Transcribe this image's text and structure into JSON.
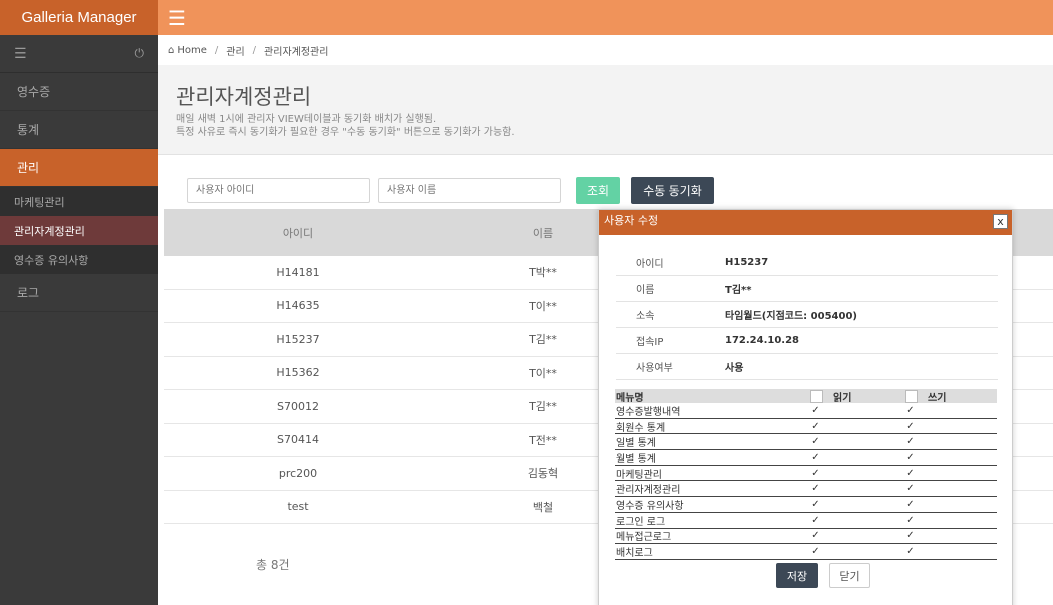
{
  "app": {
    "brand": "Galleria Manager"
  },
  "sidebar": {
    "items": [
      {
        "label": "영수증"
      },
      {
        "label": "통계"
      },
      {
        "label": "관리"
      },
      {
        "label": "마케팅관리"
      },
      {
        "label": "관리자계정관리"
      },
      {
        "label": "영수증 유의사항"
      },
      {
        "label": "로그"
      }
    ]
  },
  "breadcrumb": {
    "home": "Home",
    "level1": "관리",
    "level2": "관리자계정관리"
  },
  "page": {
    "title": "관리자계정관리",
    "desc1": "매일 새벽 1시에 관리자 VIEW테이블과 동기화 배치가 실행됨.",
    "desc2": "특정 사유로 즉시 동기화가 필요한 경우 \"수동 동기화\" 버튼으로 동기화가 가능함."
  },
  "search": {
    "id_placeholder": "사용자 아이디",
    "name_placeholder": "사용자 이름",
    "search_label": "조회",
    "sync_label": "수동 동기화"
  },
  "table": {
    "headers": {
      "id": "아이디",
      "name": "이름"
    },
    "rows": [
      {
        "id": "H14181",
        "name": "T박**"
      },
      {
        "id": "H14635",
        "name": "T이**"
      },
      {
        "id": "H15237",
        "name": "T김**"
      },
      {
        "id": "H15362",
        "name": "T이**"
      },
      {
        "id": "S70012",
        "name": "T김**"
      },
      {
        "id": "S70414",
        "name": "T전**"
      },
      {
        "id": "prc200",
        "name": "김동혁"
      },
      {
        "id": "test",
        "name": "백철"
      }
    ],
    "total": "총 8건"
  },
  "modal": {
    "title": "사용자 수정",
    "close": "x",
    "info": [
      {
        "label": "아이디",
        "value": "H15237"
      },
      {
        "label": "이름",
        "value": "T김**"
      },
      {
        "label": "소속",
        "value": "타임월드(지점코드: 005400)"
      },
      {
        "label": "접속IP",
        "value": "172.24.10.28"
      },
      {
        "label": "사용여부",
        "value": "사용"
      }
    ],
    "perm_headers": {
      "menu": "메뉴명",
      "read": "읽기",
      "write": "쓰기"
    },
    "perms": [
      {
        "menu": "영수증발행내역",
        "read": true,
        "write": true
      },
      {
        "menu": "회원수 통계",
        "read": true,
        "write": true
      },
      {
        "menu": "일별 통계",
        "read": true,
        "write": true
      },
      {
        "menu": "월별 통계",
        "read": true,
        "write": true
      },
      {
        "menu": "마케팅관리",
        "read": true,
        "write": true
      },
      {
        "menu": "관리자계정관리",
        "read": true,
        "write": true
      },
      {
        "menu": "영수증 유의사항",
        "read": true,
        "write": true
      },
      {
        "menu": "로그인 로그",
        "read": true,
        "write": true
      },
      {
        "menu": "메뉴접근로그",
        "read": true,
        "write": true
      },
      {
        "menu": "배치로그",
        "read": true,
        "write": true
      }
    ],
    "save_label": "저장",
    "close_label": "닫기"
  }
}
